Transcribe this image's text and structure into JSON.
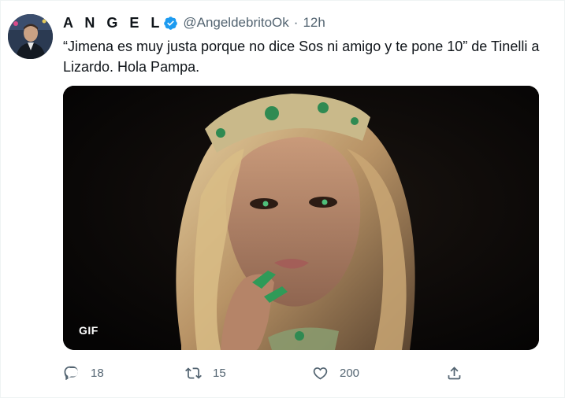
{
  "tweet": {
    "author_name": "A N G E L",
    "handle": "@AngeldebritoOk",
    "separator": "·",
    "time": "12h",
    "text": "“Jimena es muy justa porque no dice Sos ni amigo y te pone 10” de Tinelli a Lizardo. Hola Pampa.",
    "media_badge": "GIF",
    "verified_icon": "verified-badge-icon",
    "accent_color": "#1d9bf0"
  },
  "actions": {
    "reply_count": "18",
    "retweet_count": "15",
    "like_count": "200"
  }
}
